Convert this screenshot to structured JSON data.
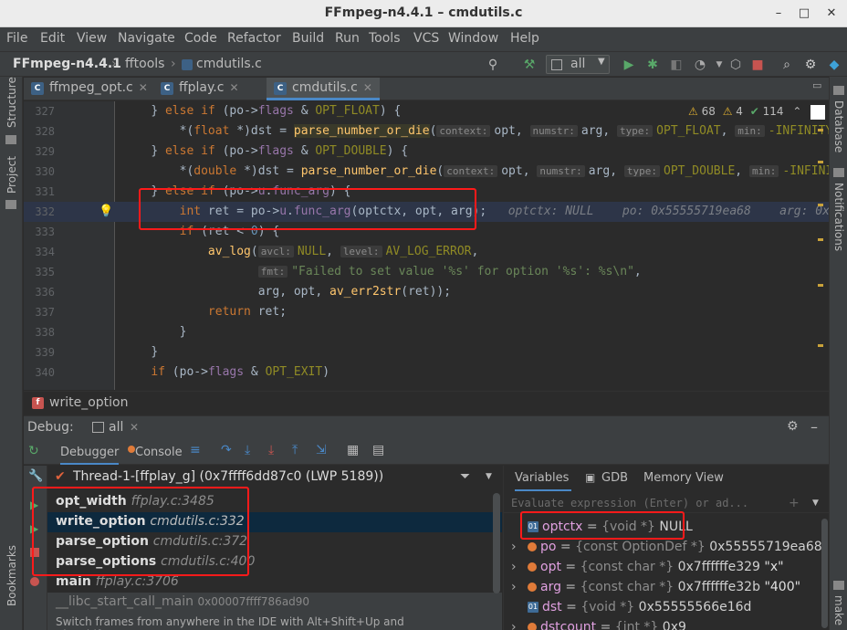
{
  "window": {
    "title": "FFmpeg-n4.4.1 – cmdutils.c"
  },
  "menu": [
    "File",
    "Edit",
    "View",
    "Navigate",
    "Code",
    "Refactor",
    "Build",
    "Run",
    "Tools",
    "VCS",
    "Window",
    "Help"
  ],
  "nav": {
    "project": "FFmpeg-n4.4.1",
    "folder": "fftools",
    "file": "cmdutils.c",
    "run_config": "all"
  },
  "tabs": [
    {
      "label": "ffmpeg_opt.c",
      "active": false
    },
    {
      "label": "ffplay.c",
      "active": false
    },
    {
      "label": "cmdutils.c",
      "active": true
    }
  ],
  "inspections": {
    "warnings": "68",
    "weak": "4",
    "typos": "114"
  },
  "side_left": [
    "Structure",
    "Project",
    "Bookmarks"
  ],
  "side_right": [
    "Database",
    "Notifications",
    "make"
  ],
  "code_lines": [
    {
      "num": "327"
    },
    {
      "num": "328"
    },
    {
      "num": "329"
    },
    {
      "num": "330"
    },
    {
      "num": "331"
    },
    {
      "num": "332"
    },
    {
      "num": "333"
    },
    {
      "num": "334"
    },
    {
      "num": "335"
    },
    {
      "num": "336"
    },
    {
      "num": "337"
    },
    {
      "num": "338"
    },
    {
      "num": "339"
    },
    {
      "num": "340"
    }
  ],
  "code": {
    "l327": [
      "} ",
      "else if",
      " (po->",
      "flags",
      " & ",
      "OPT_FLOAT",
      ") {"
    ],
    "l328": [
      "*(",
      "float",
      " *)dst = ",
      "parse_number_or_die",
      "(",
      "context:",
      "opt, ",
      "numstr:",
      "arg, ",
      "type:",
      "OPT_FLOAT",
      ", ",
      "min:",
      "-INFINITY",
      ","
    ],
    "l329": [
      "} ",
      "else if",
      " (po->",
      "flags",
      " & ",
      "OPT_DOUBLE",
      ") {"
    ],
    "l330": [
      "*(",
      "double",
      " *)dst = ",
      "parse_number_or_die",
      "(",
      "context:",
      "opt, ",
      "numstr:",
      "arg, ",
      "type:",
      "OPT_DOUBLE",
      ", ",
      "min:",
      "-INFINITY"
    ],
    "l331": [
      "} ",
      "else if",
      " (po->",
      "u",
      ".",
      "func_arg",
      ") {"
    ],
    "l332": [
      "int",
      " ret = po->",
      "u",
      ".",
      "func_arg",
      "(optctx, opt, arg);",
      "optctx: NULL",
      "po: 0x55555719ea68",
      "arg: 0x"
    ],
    "l333": [
      "if",
      " (ret < ",
      "0",
      ") {"
    ],
    "l334": [
      "av_log",
      "(",
      "avcl:",
      "NULL",
      ", ",
      "level:",
      "AV_LOG_ERROR",
      ","
    ],
    "l335": [
      "fmt:",
      "\"Failed to set value '%s' for option '%s': %s\\n\"",
      ","
    ],
    "l336": [
      "arg, opt, ",
      "av_err2str",
      "(ret));"
    ],
    "l337": [
      "return",
      " ret;"
    ],
    "l338": [
      "}"
    ],
    "l339": [
      "}"
    ],
    "l340": [
      "if",
      " (po->",
      "flags",
      " & ",
      "OPT_EXIT",
      ")"
    ]
  },
  "editor_breadcrumb": "write_option",
  "debug": {
    "label": "Debug:",
    "session": "all",
    "tabs": [
      "Debugger",
      "Console"
    ],
    "thread": "Thread-1-[ffplay_g] (0x7ffff6dd87c0 (LWP 5189))",
    "frames": [
      {
        "name": "opt_width",
        "loc": "ffplay.c:3485",
        "selected": false
      },
      {
        "name": "write_option",
        "loc": "cmdutils.c:332",
        "selected": true
      },
      {
        "name": "parse_option",
        "loc": "cmdutils.c:372",
        "selected": false
      },
      {
        "name": "parse_options",
        "loc": "cmdutils.c:400",
        "selected": false
      },
      {
        "name": "main",
        "loc": "ffplay.c:3706",
        "selected": false
      },
      {
        "name": "__libc_start_call_main",
        "loc": "0x00007ffff786ad90",
        "selected": false
      }
    ],
    "status_hint": "Switch frames from anywhere in the IDE with Alt+Shift+Up and Alt+Shift+Down",
    "var_tabs": [
      "Variables",
      "GDB",
      "Memory View"
    ],
    "eval_placeholder": "Evaluate expression (Enter) or ad...",
    "variables": [
      {
        "name": "optctx",
        "type": "{void *}",
        "value": "NULL",
        "expandable": false,
        "icon": "01"
      },
      {
        "name": "po",
        "type": "{const OptionDef *}",
        "value": "0x55555719ea68",
        "expandable": true,
        "icon": "dot"
      },
      {
        "name": "opt",
        "type": "{const char *}",
        "value": "0x7ffffffe329",
        "extra": "\"x\"",
        "expandable": true,
        "icon": "dot"
      },
      {
        "name": "arg",
        "type": "{const char *}",
        "value": "0x7ffffffe32b",
        "extra": "\"400\"",
        "expandable": true,
        "icon": "dot"
      },
      {
        "name": "dst",
        "type": "{void *}",
        "value": "0x55555566e16d",
        "expandable": false,
        "icon": "01"
      },
      {
        "name": "dstcount",
        "type": "{int *}",
        "value": "0x9",
        "expandable": true,
        "icon": "dot"
      }
    ]
  },
  "colors": {
    "highlight": "#ff1a1a",
    "accent": "#4a88c7"
  }
}
